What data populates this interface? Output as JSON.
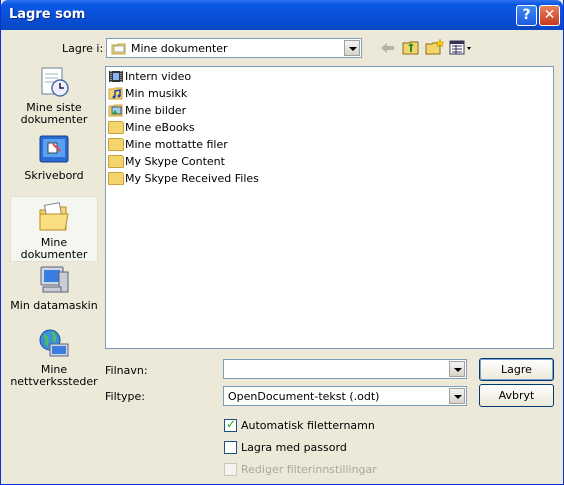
{
  "window": {
    "title": "Lagre som",
    "help": "?",
    "close": "✕"
  },
  "location": {
    "label": "Lagre i:",
    "value": "Mine dokumenter"
  },
  "places": [
    {
      "line1": "Mine siste",
      "line2": "dokumenter"
    },
    {
      "line1": "Skrivebord",
      "line2": ""
    },
    {
      "line1": "Mine",
      "line2": "dokumenter"
    },
    {
      "line1": "Min datamaskin",
      "line2": ""
    },
    {
      "line1": "Mine",
      "line2": "nettverkssteder"
    }
  ],
  "files": [
    "Intern video",
    "Min musikk",
    "Mine bilder",
    "Mine eBooks",
    "Mine mottatte filer",
    "My Skype Content",
    "My Skype Received Files"
  ],
  "filename": {
    "label": "Filnavn:",
    "value": ""
  },
  "filetype": {
    "label": "Filtype:",
    "value": "OpenDocument-tekst (.odt)"
  },
  "buttons": {
    "save": "Lagre",
    "cancel": "Avbryt"
  },
  "options": [
    {
      "label": "Automatisk filetternamn",
      "checked": true,
      "enabled": true
    },
    {
      "label": "Lagra med passord",
      "checked": false,
      "enabled": true
    },
    {
      "label": "Rediger filterinnstillingar",
      "checked": false,
      "enabled": false
    }
  ]
}
